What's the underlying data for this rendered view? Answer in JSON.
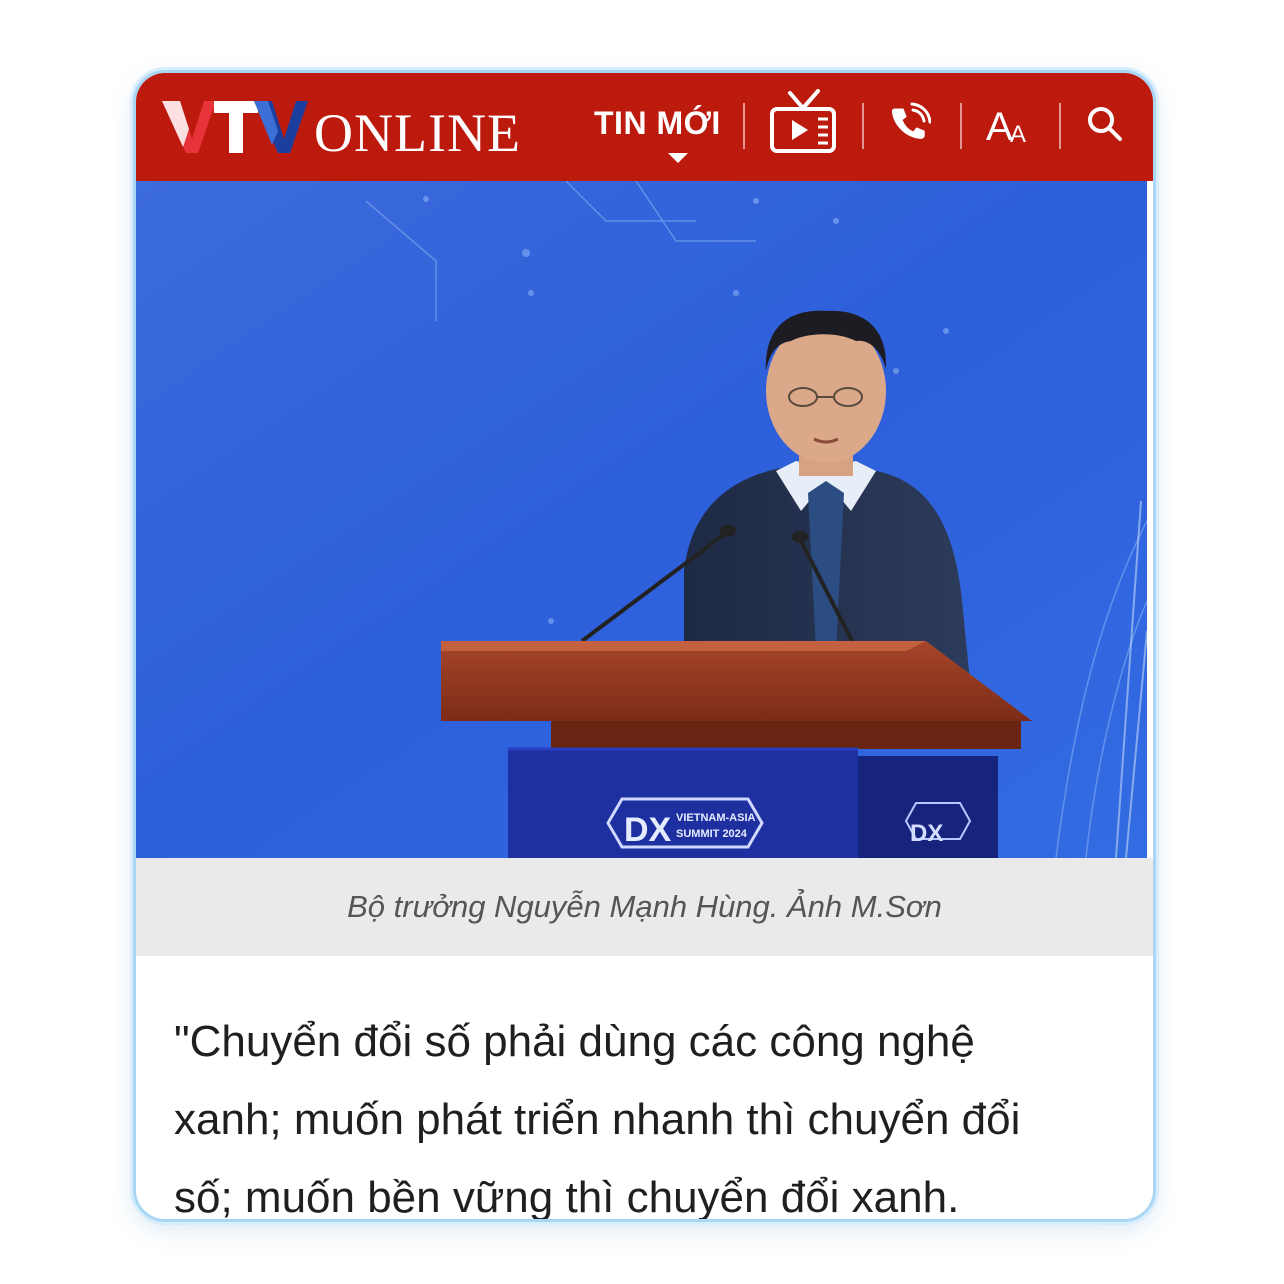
{
  "header": {
    "logo_text": "VTV ONLINE",
    "nav_label": "TIN MỚI",
    "icons": [
      "tv-play-icon",
      "phone-call-icon",
      "font-size-icon",
      "search-icon"
    ],
    "background_color": "#bd1a0e"
  },
  "article": {
    "photo_event_logo_line1": "VIETNAM-ASIA",
    "photo_event_logo_line2": "SUMMIT 2024",
    "photo_event_logo_mark": "DX",
    "caption": "Bộ trưởng Nguyễn Mạnh Hùng. Ảnh M.Sơn",
    "body_lines": [
      "\"Chuyển đổi số phải dùng các công nghệ",
      "xanh; muốn phát triển nhanh thì chuyển đổi",
      "số; muốn bền vững thì chuyển đổi xanh."
    ]
  }
}
